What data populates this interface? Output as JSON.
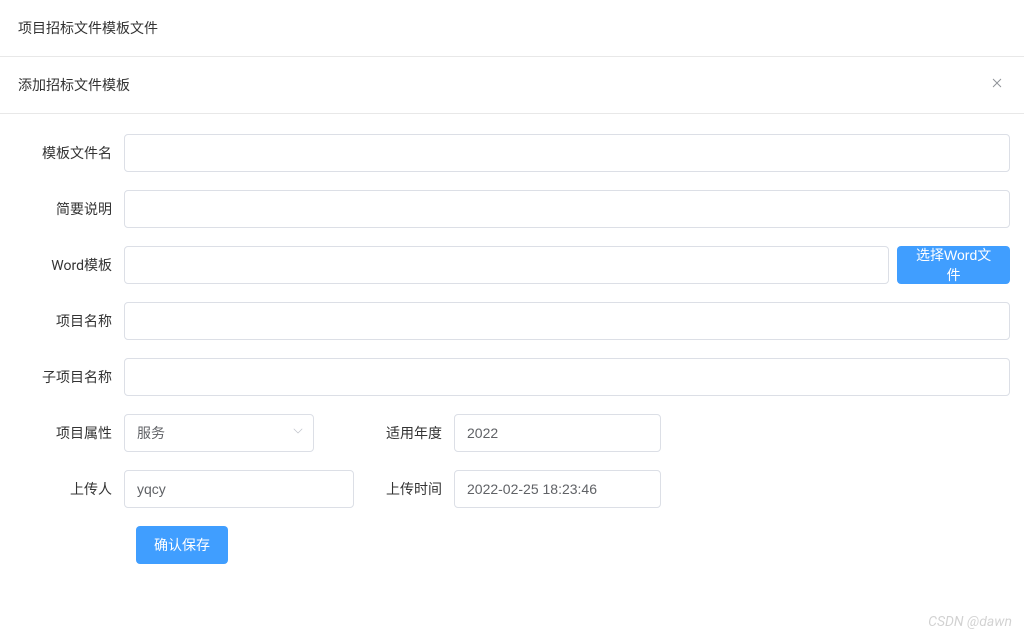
{
  "page": {
    "title": "项目招标文件模板文件"
  },
  "dialog": {
    "title": "添加招标文件模板"
  },
  "form": {
    "template_file_name": {
      "label": "模板文件名",
      "value": ""
    },
    "brief_desc": {
      "label": "简要说明",
      "value": ""
    },
    "word_template": {
      "label": "Word模板",
      "value": "",
      "button": "选择Word文件"
    },
    "project_name": {
      "label": "项目名称",
      "value": ""
    },
    "sub_project_name": {
      "label": "子项目名称",
      "value": ""
    },
    "project_attr": {
      "label": "项目属性",
      "value": "服务"
    },
    "applicable_year": {
      "label": "适用年度",
      "value": "2022"
    },
    "uploader": {
      "label": "上传人",
      "value": "yqcy"
    },
    "upload_time": {
      "label": "上传时间",
      "value": "2022-02-25 18:23:46"
    },
    "submit": "确认保存"
  },
  "watermark": "CSDN @dawn"
}
